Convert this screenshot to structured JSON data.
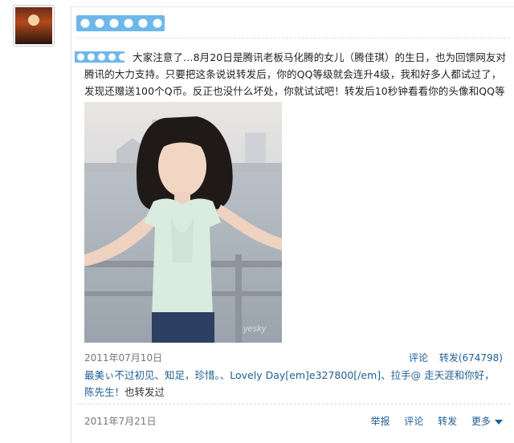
{
  "post": {
    "text": "大家注意了…8月20日是腾讯老板马化腾的女儿（腾佳琪）的生日，也为回馈网友对腾讯的大力支持。只要把这条说说转发后，你的QQ等级就会连升4级，我和好多人都试过了，发现还赠送100个Q币。反正也没什么坏处，你就试试吧！转发后10秒钟看看你的头像和QQ等级。",
    "image_watermark": "yesky",
    "date": "2011年07月10日",
    "comment_label": "评论",
    "forward_label": "转发(674798)",
    "forwarders_names": "最美ぃ不过初见、知足，珍惜。、Lovely Day[em]e327800[/em]、拉手@ 走天涯和你好，陈先生！",
    "forwarders_suffix": "也转发过"
  },
  "footer": {
    "date": "2011年7月21日",
    "report_label": "举报",
    "comment_label": "评论",
    "forward_label": "转发",
    "more_label": "更多"
  },
  "colors": {
    "link": "#1f5e93",
    "banner": "#6db7ea"
  },
  "icons": [
    "avatar",
    "chevron-down-icon"
  ]
}
